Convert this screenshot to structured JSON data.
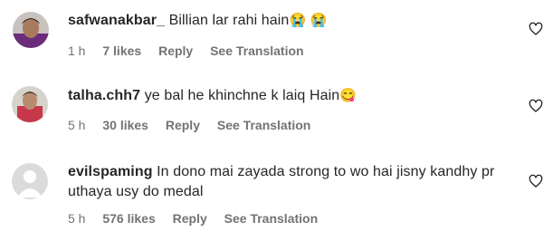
{
  "comments": [
    {
      "username": "safwanakbar_",
      "text": "Billian lar rahi hain",
      "emoji": "😭 😭",
      "time": "1 h",
      "likes": "7 likes",
      "reply": "Reply",
      "translate": "See Translation"
    },
    {
      "username": "talha.chh7",
      "text": "ye bal he khinchne k laiq Hain",
      "emoji": "😋",
      "time": "5 h",
      "likes": "30 likes",
      "reply": "Reply",
      "translate": "See Translation"
    },
    {
      "username": "evilspaming",
      "text": "In dono mai zayada strong to wo hai jisny kandhy pr uthaya usy do medal",
      "emoji": "",
      "time": "5 h",
      "likes": "576 likes",
      "reply": "Reply",
      "translate": "See Translation"
    }
  ],
  "icons": {
    "like": "heart-outline-icon",
    "default_avatar": "default-avatar-icon"
  }
}
